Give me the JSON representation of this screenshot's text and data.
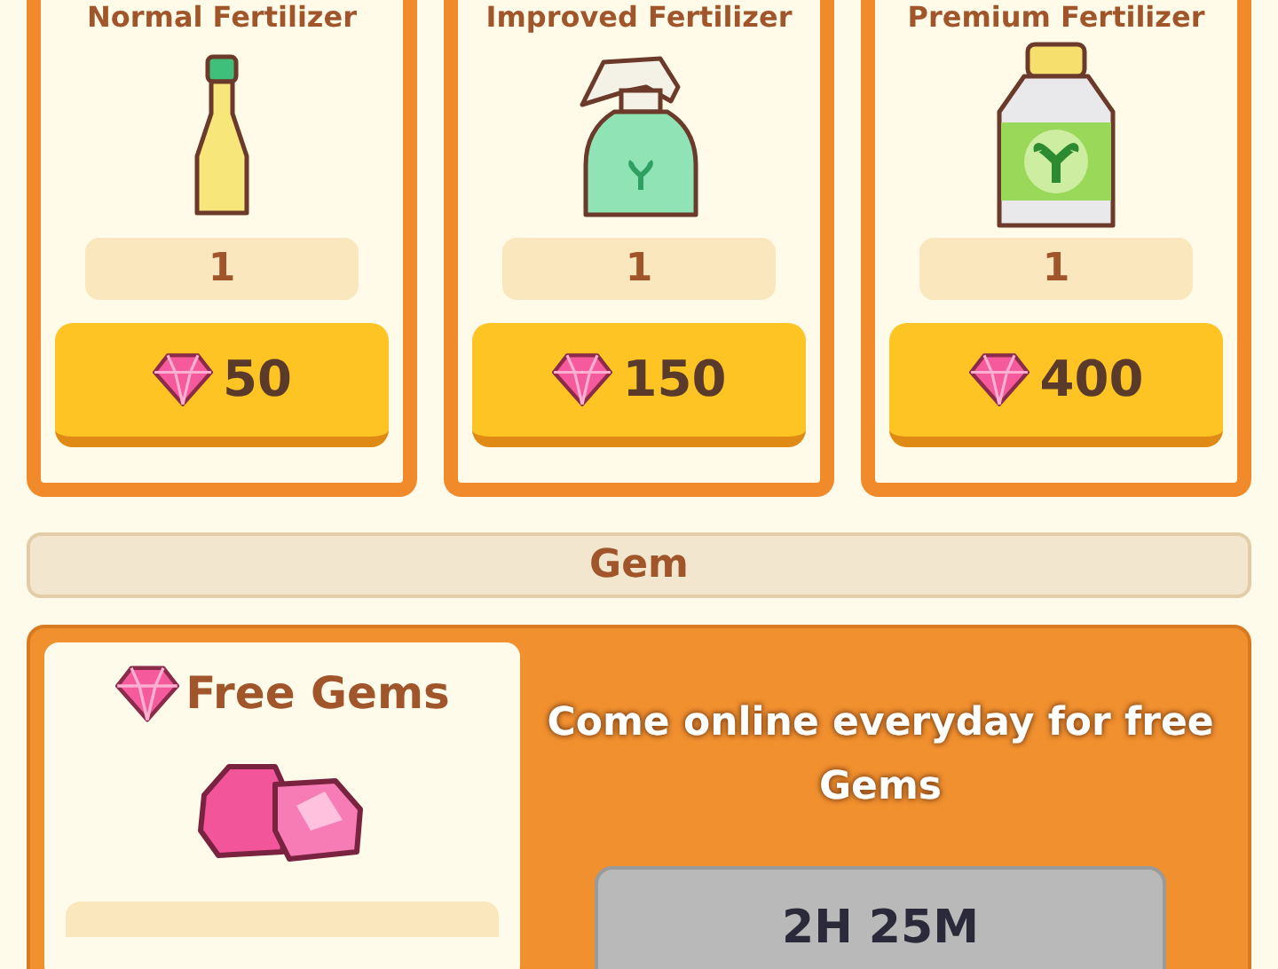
{
  "fertilizers": [
    {
      "name": "Normal Fertilizer",
      "kind": "bottle",
      "quantity": "1",
      "price": "50"
    },
    {
      "name": "Improved Fertilizer",
      "kind": "spray",
      "quantity": "1",
      "price": "150"
    },
    {
      "name": "Premium Fertilizer",
      "kind": "jar",
      "quantity": "1",
      "price": "400"
    }
  ],
  "gem_section": {
    "title": "Gem"
  },
  "free_gems": {
    "title": "Free Gems",
    "message": "Come online everyday for free Gems",
    "timer": "2H 25M"
  }
}
